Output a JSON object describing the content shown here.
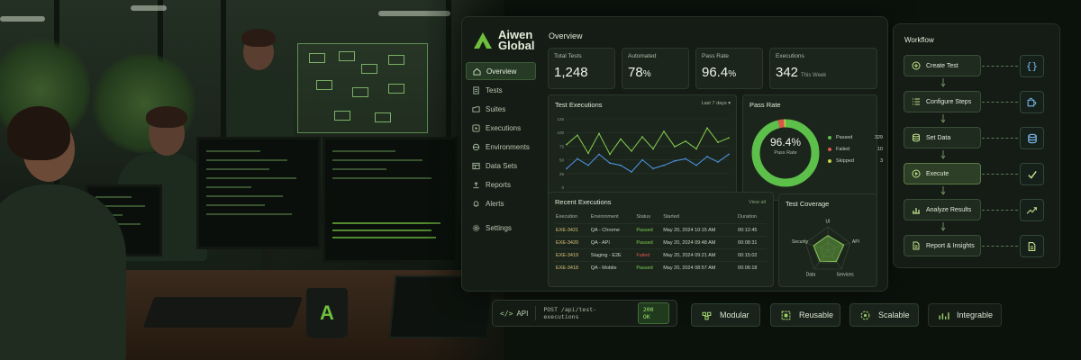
{
  "brand": {
    "name_line1": "Aiwen",
    "name_line2": "Global",
    "accent": "#6fbf3f"
  },
  "sidebar": {
    "items": [
      {
        "label": "Overview",
        "icon": "home-icon",
        "active": true
      },
      {
        "label": "Tests",
        "icon": "document-icon"
      },
      {
        "label": "Suites",
        "icon": "folder-icon"
      },
      {
        "label": "Executions",
        "icon": "play-icon"
      },
      {
        "label": "Environments",
        "icon": "environment-icon"
      },
      {
        "label": "Data Sets",
        "icon": "table-icon"
      },
      {
        "label": "Reports",
        "icon": "upload-icon"
      },
      {
        "label": "Alerts",
        "icon": "bell-icon"
      },
      {
        "label": "Settings",
        "icon": "gear-icon"
      }
    ]
  },
  "overview": {
    "title": "Overview",
    "stats": [
      {
        "label": "Total Tests",
        "value": "1,248",
        "unit": "",
        "sub": ""
      },
      {
        "label": "Automated",
        "value": "78",
        "unit": "%",
        "sub": ""
      },
      {
        "label": "Pass Rate",
        "value": "96.4",
        "unit": "%",
        "sub": ""
      },
      {
        "label": "Executions",
        "value": "342",
        "unit": "",
        "sub": "This Week"
      }
    ]
  },
  "executions_chart": {
    "title": "Test Executions",
    "range": "Last 7 days",
    "colors": [
      "#7fc24a",
      "#4a8fd6"
    ]
  },
  "chart_data": {
    "type": "line",
    "title": "Test Executions",
    "xlabel": "",
    "ylabel": "",
    "y_ticks": [
      "125",
      "100",
      "75",
      "50",
      "25",
      "0"
    ],
    "x_ticks": [
      "2011",
      "2012",
      "2013",
      "2014",
      "2015",
      "2016"
    ],
    "ylim": [
      0,
      125
    ],
    "grid": true,
    "series": [
      {
        "values": [
          78,
          95,
          62,
          98,
          60,
          88,
          66,
          92,
          70,
          102,
          74,
          84,
          70,
          108,
          82,
          90
        ]
      },
      {
        "values": [
          34,
          52,
          40,
          60,
          44,
          40,
          28,
          50,
          34,
          40,
          48,
          52,
          40,
          56,
          46,
          60
        ]
      }
    ]
  },
  "pass_rate": {
    "title": "Pass Rate",
    "center_value": "96.4%",
    "center_label": "Pass Rate",
    "legend": [
      {
        "label": "Passed",
        "value": "329",
        "color": "#5cc04a"
      },
      {
        "label": "Failed",
        "value": "10",
        "color": "#d9574a"
      },
      {
        "label": "Skipped",
        "value": "3",
        "color": "#c9d24a"
      }
    ],
    "fractions": {
      "passed": 0.962,
      "failed": 0.029,
      "skipped": 0.009
    }
  },
  "recent": {
    "title": "Recent Executions",
    "view_all": "View all",
    "columns": [
      "Execution",
      "Environment",
      "Status",
      "Started",
      "Duration"
    ],
    "rows": [
      {
        "id": "EXE-3421",
        "env": "QA - Chrome",
        "status": "Passed",
        "started": "May 20, 2024 10:15 AM",
        "duration": "00:12:45"
      },
      {
        "id": "EXE-3420",
        "env": "QA - API",
        "status": "Passed",
        "started": "May 20, 2024 09:48 AM",
        "duration": "00:08:31"
      },
      {
        "id": "EXE-3419",
        "env": "Staging - E2E",
        "status": "Failed",
        "started": "May 20, 2024 09:21 AM",
        "duration": "00:15:02"
      },
      {
        "id": "EXE-3418",
        "env": "QA - Mobile",
        "status": "Passed",
        "started": "May 20, 2024 08:57 AM",
        "duration": "00:06:18"
      }
    ]
  },
  "coverage": {
    "title": "Test Coverage",
    "axes": [
      "UI",
      "API",
      "Services",
      "Data",
      "Security"
    ],
    "values": [
      0.62,
      0.72,
      0.6,
      0.58,
      0.64
    ]
  },
  "workflow": {
    "title": "Workflow",
    "steps": [
      {
        "label": "Create Test",
        "step_icon": "plus-circle-icon",
        "side_icon": "braces-icon"
      },
      {
        "label": "Configure Steps",
        "step_icon": "list-icon",
        "side_icon": "puzzle-icon"
      },
      {
        "label": "Set Data",
        "step_icon": "database-icon",
        "side_icon": "database-icon"
      },
      {
        "label": "Execute",
        "step_icon": "play-circle-icon",
        "side_icon": "check-icon"
      },
      {
        "label": "Analyze Results",
        "step_icon": "bar-chart-icon",
        "side_icon": "trend-up-icon"
      },
      {
        "label": "Report & Insights",
        "step_icon": "report-icon",
        "side_icon": "report-icon"
      }
    ]
  },
  "api_bar": {
    "label": "API",
    "endpoint": "POST /api/test-executions",
    "status": "200 OK"
  },
  "features": [
    {
      "label": "Modular",
      "icon": "modular-icon"
    },
    {
      "label": "Reusable",
      "icon": "reusable-icon"
    },
    {
      "label": "Scalable",
      "icon": "scalable-icon"
    },
    {
      "label": "Integrable",
      "icon": "integrable-icon"
    }
  ],
  "mug_logo": "A"
}
